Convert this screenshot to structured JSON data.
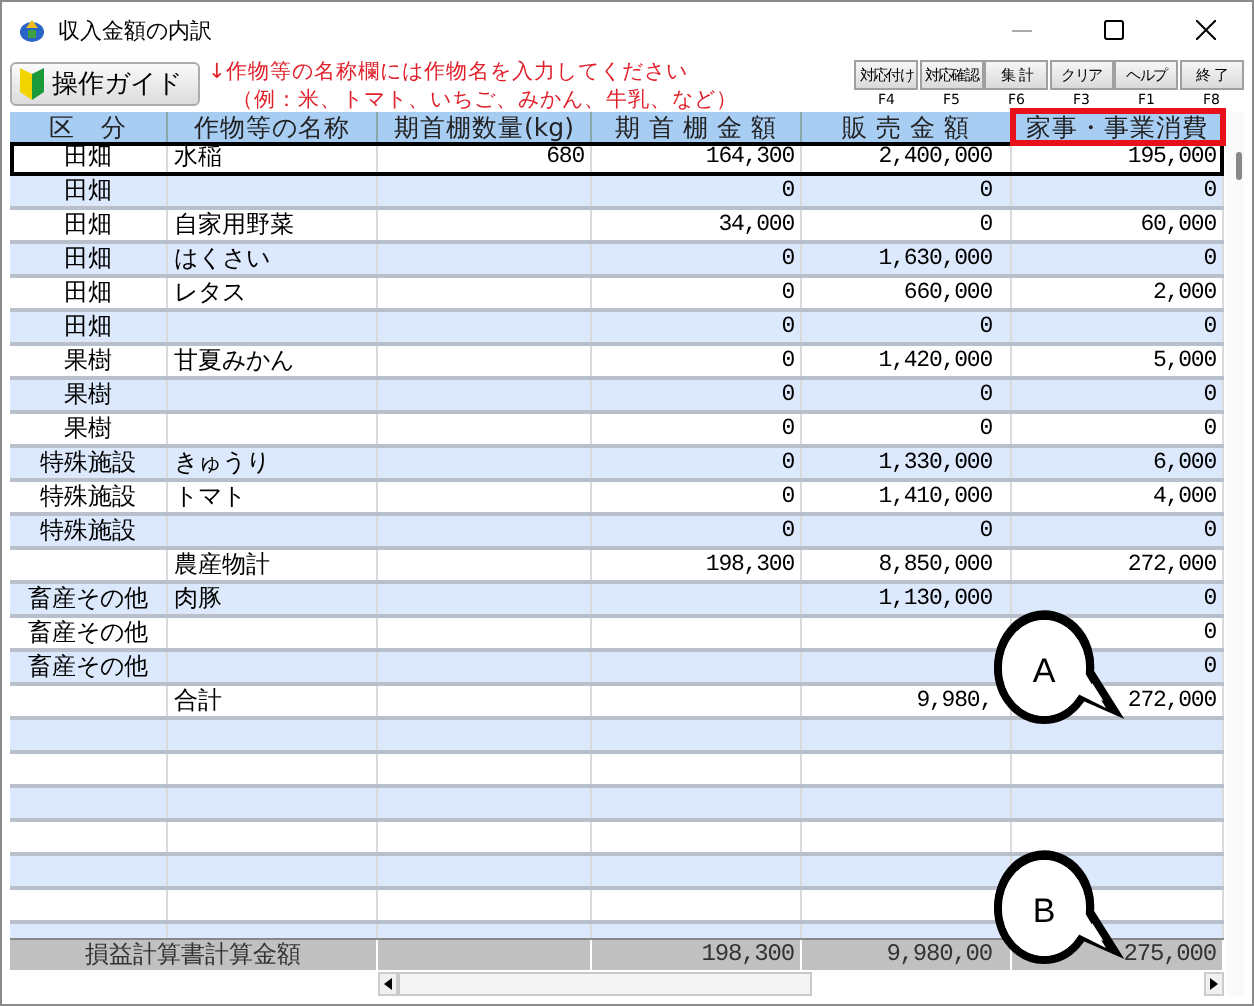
{
  "window": {
    "title": "収入金額の内訳"
  },
  "toolbar": {
    "guide_button": "操作ガイド",
    "notes": [
      "↓作物等の名称欄には作物名を入力してください",
      "（例：米、トマト、いちご、みかん、牛乳、など）"
    ],
    "function_buttons": [
      {
        "label": "対応付け",
        "key": "F4"
      },
      {
        "label": "対応確認",
        "key": "F5"
      },
      {
        "label": "集 計",
        "key": "F6"
      },
      {
        "label": "クリア",
        "key": "F3"
      },
      {
        "label": "ヘルプ",
        "key": "F1"
      },
      {
        "label": "終 了",
        "key": "F8"
      }
    ]
  },
  "table": {
    "columns": [
      {
        "label": "区　分",
        "highlighted": false
      },
      {
        "label": "作物等の名称",
        "highlighted": false
      },
      {
        "label": "期首棚数量(kg)",
        "highlighted": false
      },
      {
        "label": "期 首 棚 金 額",
        "highlighted": false
      },
      {
        "label": "販 売 金 額",
        "highlighted": false
      },
      {
        "label": "家事・事業消費",
        "highlighted": true
      }
    ],
    "rows": [
      {
        "category": "田畑",
        "name": "水稲",
        "quantity": "680",
        "opening_amount": "164,300",
        "sales": "2,400,000",
        "household": "195,000",
        "selected": true
      },
      {
        "category": "田畑",
        "opening_amount": "0",
        "sales": "0",
        "household": "0",
        "selected": false
      },
      {
        "category": "田畑",
        "name": "自家用野菜",
        "opening_amount": "34,000",
        "sales": "0",
        "household": "60,000",
        "selected": false
      },
      {
        "category": "田畑",
        "name": "はくさい",
        "opening_amount": "0",
        "sales": "1,630,000",
        "household": "0",
        "selected": false
      },
      {
        "category": "田畑",
        "name": "レタス",
        "opening_amount": "0",
        "sales": "660,000",
        "household": "2,000",
        "selected": false
      },
      {
        "category": "田畑",
        "opening_amount": "0",
        "sales": "0",
        "household": "0",
        "selected": false
      },
      {
        "category": "果樹",
        "name": "甘夏みかん",
        "opening_amount": "0",
        "sales": "1,420,000",
        "household": "5,000",
        "selected": false
      },
      {
        "category": "果樹",
        "opening_amount": "0",
        "sales": "0",
        "household": "0",
        "selected": false
      },
      {
        "category": "果樹",
        "opening_amount": "0",
        "sales": "0",
        "household": "0",
        "selected": false
      },
      {
        "category": "特殊施設",
        "name": "きゅうり",
        "opening_amount": "0",
        "sales": "1,330,000",
        "household": "6,000",
        "selected": false
      },
      {
        "category": "特殊施設",
        "name": "トマト",
        "opening_amount": "0",
        "sales": "1,410,000",
        "household": "4,000",
        "selected": false
      },
      {
        "category": "特殊施設",
        "opening_amount": "0",
        "sales": "0",
        "household": "0",
        "selected": false
      },
      {
        "name": "農産物計",
        "opening_amount": "198,300",
        "sales": "8,850,000",
        "household": "272,000",
        "selected": false
      },
      {
        "category": "畜産その他",
        "name": "肉豚",
        "sales": "1,130,000",
        "household": "0",
        "selected": false
      },
      {
        "category": "畜産その他",
        "household": "0",
        "selected": false
      },
      {
        "category": "畜産その他",
        "household": "0",
        "selected": false
      },
      {
        "name": "合計",
        "sales": "9,980,",
        "household": "272,000",
        "selected": false
      }
    ],
    "footer": {
      "label": "損益計算書計算金額",
      "opening_amount": "198,300",
      "sales": "9,980,00",
      "household": "275,000"
    }
  },
  "callouts": [
    {
      "label": "A"
    },
    {
      "label": "B"
    }
  ]
}
